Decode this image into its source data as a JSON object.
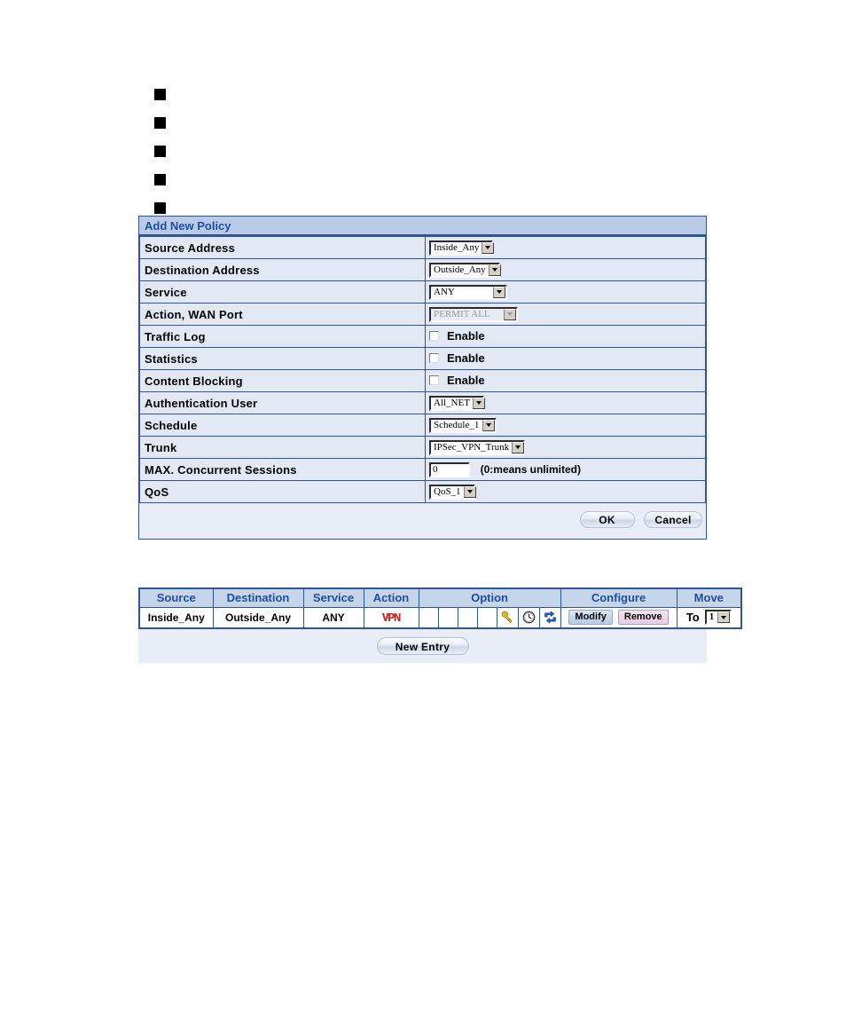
{
  "bullets": [
    {
      "marker": "■",
      "text": ""
    },
    {
      "marker": "■",
      "text": ""
    },
    {
      "marker": "■",
      "text": ""
    },
    {
      "marker": "■",
      "text": ""
    },
    {
      "marker": "■",
      "text": ""
    }
  ],
  "policy_panel": {
    "title": "Add New Policy",
    "rows": [
      {
        "label": "Source Address",
        "control": "select",
        "value": "Inside_Any"
      },
      {
        "label": "Destination Address",
        "control": "select",
        "value": "Outside_Any"
      },
      {
        "label": "Service",
        "control": "select",
        "value": "ANY"
      },
      {
        "label": "Action, WAN Port",
        "control": "select",
        "value": "PERMIT ALL",
        "disabled": true
      },
      {
        "label": "Traffic Log",
        "control": "checkbox",
        "value": "Enable",
        "checked": false
      },
      {
        "label": "Statistics",
        "control": "checkbox",
        "value": "Enable",
        "checked": false
      },
      {
        "label": "Content Blocking",
        "control": "checkbox",
        "value": "Enable",
        "checked": false
      },
      {
        "label": "Authentication User",
        "control": "select",
        "value": "All_NET"
      },
      {
        "label": "Schedule",
        "control": "select",
        "value": "Schedule_1"
      },
      {
        "label": "Trunk",
        "control": "select",
        "value": "IPSec_VPN_Trunk"
      },
      {
        "label": "MAX. Concurrent Sessions",
        "control": "text",
        "value": "0",
        "hint": "(0:means unlimited)"
      },
      {
        "label": "QoS",
        "control": "select",
        "value": "QoS_1"
      }
    ],
    "buttons": {
      "ok": "OK",
      "cancel": "Cancel"
    }
  },
  "policy_list": {
    "headers": [
      "Source",
      "Destination",
      "Service",
      "Action",
      "Option",
      "Configure",
      "Move"
    ],
    "row": {
      "source": "Inside_Any",
      "destination": "Outside_Any",
      "service": "ANY",
      "action": "VPN",
      "option_icons": [
        "",
        "",
        "",
        "",
        "key-icon",
        "clock-icon",
        "sync-icon"
      ],
      "modify": "Modify",
      "remove": "Remove",
      "move_label": "To",
      "move_value": "1"
    },
    "new_entry": "New Entry"
  },
  "colors": {
    "panel_border": "#2f5597",
    "header_bg": "#b9cbe8",
    "header_text": "#1f4e9c",
    "row_bg": "#e2e9f5",
    "list_header_bg": "#c5d5ea",
    "vpn_red": "#d02a2a",
    "key_yellow": "#f2d413",
    "sync_blue": "#2a5fd0"
  }
}
